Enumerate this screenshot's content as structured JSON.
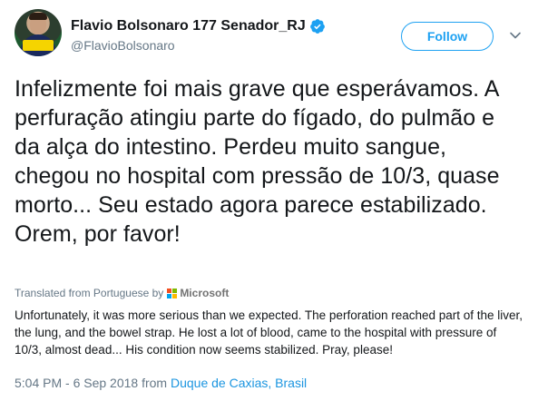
{
  "colors": {
    "accent": "#1da1f2",
    "text": "#14171a",
    "muted": "#657786",
    "link": "#1b95e0",
    "verified": "#1da1f2"
  },
  "author": {
    "display_name": "Flavio Bolsonaro 177 Senador_RJ",
    "handle": "@FlavioBolsonaro",
    "avatar_badge_text": "BOLSONARO PRESIDENTE SENADOR 177",
    "verified_icon": "verified-badge-icon"
  },
  "actions": {
    "follow_label": "Follow",
    "more_icon": "chevron-down-icon"
  },
  "tweet": {
    "text": "Infelizmente foi mais grave que esperávamos. A perfuração atingiu parte do fígado, do pulmão e da alça do intestino. Perdeu muito sangue, chegou no hospital com pressão de 10/3, quase morto... Seu estado agora parece estabilizado. Orem, por favor!",
    "translated_from": "Translated from Portuguese by",
    "translator_brand": "Microsoft",
    "translation": "Unfortunately, it was more serious than we expected. The perforation reached part of the liver, the lung, and the bowel strap. He lost a lot of blood, came to the hospital with pressure of 10/3, almost dead... His condition now seems stabilized. Pray, please!",
    "timestamp": "5:04 PM - 6 Sep 2018",
    "from_label": "from",
    "place": "Duque de Caxias, Brasil"
  }
}
